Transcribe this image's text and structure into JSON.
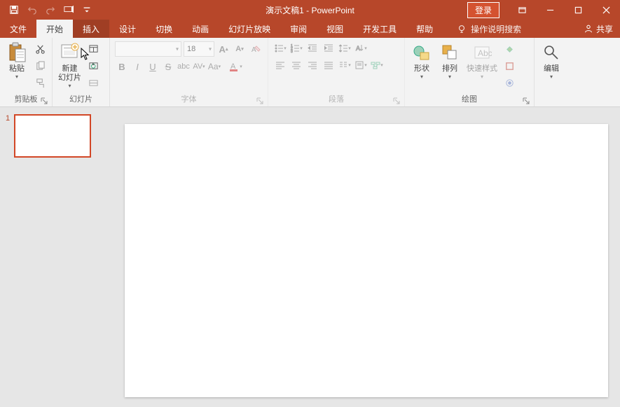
{
  "app": {
    "title": "演示文稿1  -  PowerPoint",
    "login": "登录",
    "share": "共享"
  },
  "tabs": {
    "file": "文件",
    "home": "开始",
    "insert": "插入",
    "design": "设计",
    "transitions": "切换",
    "animations": "动画",
    "slideshow": "幻灯片放映",
    "review": "审阅",
    "view": "视图",
    "developer": "开发工具",
    "help": "帮助",
    "tellme": "操作说明搜索"
  },
  "ribbon": {
    "clipboard": {
      "label": "剪贴板",
      "paste": "粘贴"
    },
    "slides": {
      "label": "幻灯片",
      "newslide": "新建\n幻灯片"
    },
    "font": {
      "label": "字体",
      "fontname": "",
      "fontsize": "18"
    },
    "paragraph": {
      "label": "段落"
    },
    "drawing": {
      "label": "绘图",
      "shapes": "形状",
      "arrange": "排列",
      "quickstyles": "快速样式"
    },
    "editing": {
      "label": "编辑"
    }
  },
  "slides_panel": {
    "slide1_num": "1"
  }
}
